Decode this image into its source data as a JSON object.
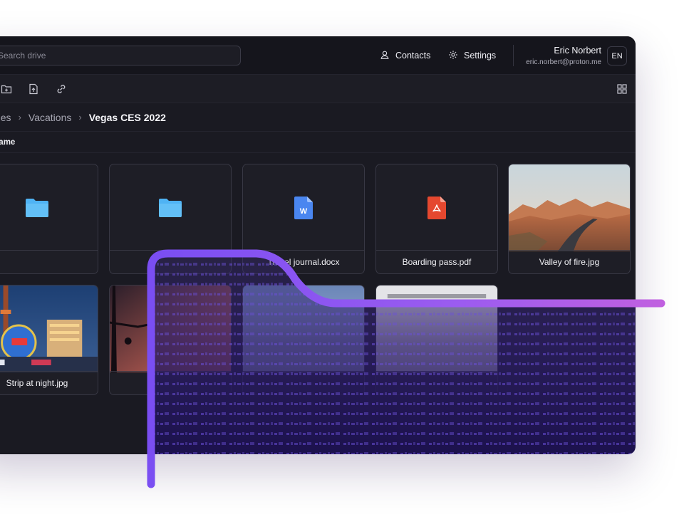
{
  "search": {
    "placeholder": "Search drive"
  },
  "header": {
    "contacts_label": "Contacts",
    "settings_label": "Settings",
    "user_name": "Eric Norbert",
    "user_email": "eric.norbert@proton.me",
    "language": "EN"
  },
  "breadcrumb": {
    "items": [
      "Files",
      "Vacations",
      "Vegas CES 2022"
    ]
  },
  "table": {
    "name_header": "Name"
  },
  "files": [
    {
      "name": "",
      "type": "folder"
    },
    {
      "name": "",
      "type": "folder"
    },
    {
      "name": "Travel journal.docx",
      "type": "docx"
    },
    {
      "name": "Boarding pass.pdf",
      "type": "pdf"
    },
    {
      "name": "Valley of fire.jpg",
      "type": "image"
    },
    {
      "name": "Strip at night.jpg",
      "type": "image"
    },
    {
      "name": "",
      "type": "image"
    },
    {
      "name": "",
      "type": "image"
    },
    {
      "name": "",
      "type": "image"
    }
  ],
  "colors": {
    "accent": "#8a5cf6",
    "folder": "#4fb3f4",
    "docx": "#4a86f0",
    "pdf": "#e5482f"
  },
  "icons": [
    "search-icon",
    "contacts-icon",
    "gear-icon",
    "new-folder-icon",
    "upload-file-icon",
    "link-icon",
    "grid-view-icon"
  ]
}
